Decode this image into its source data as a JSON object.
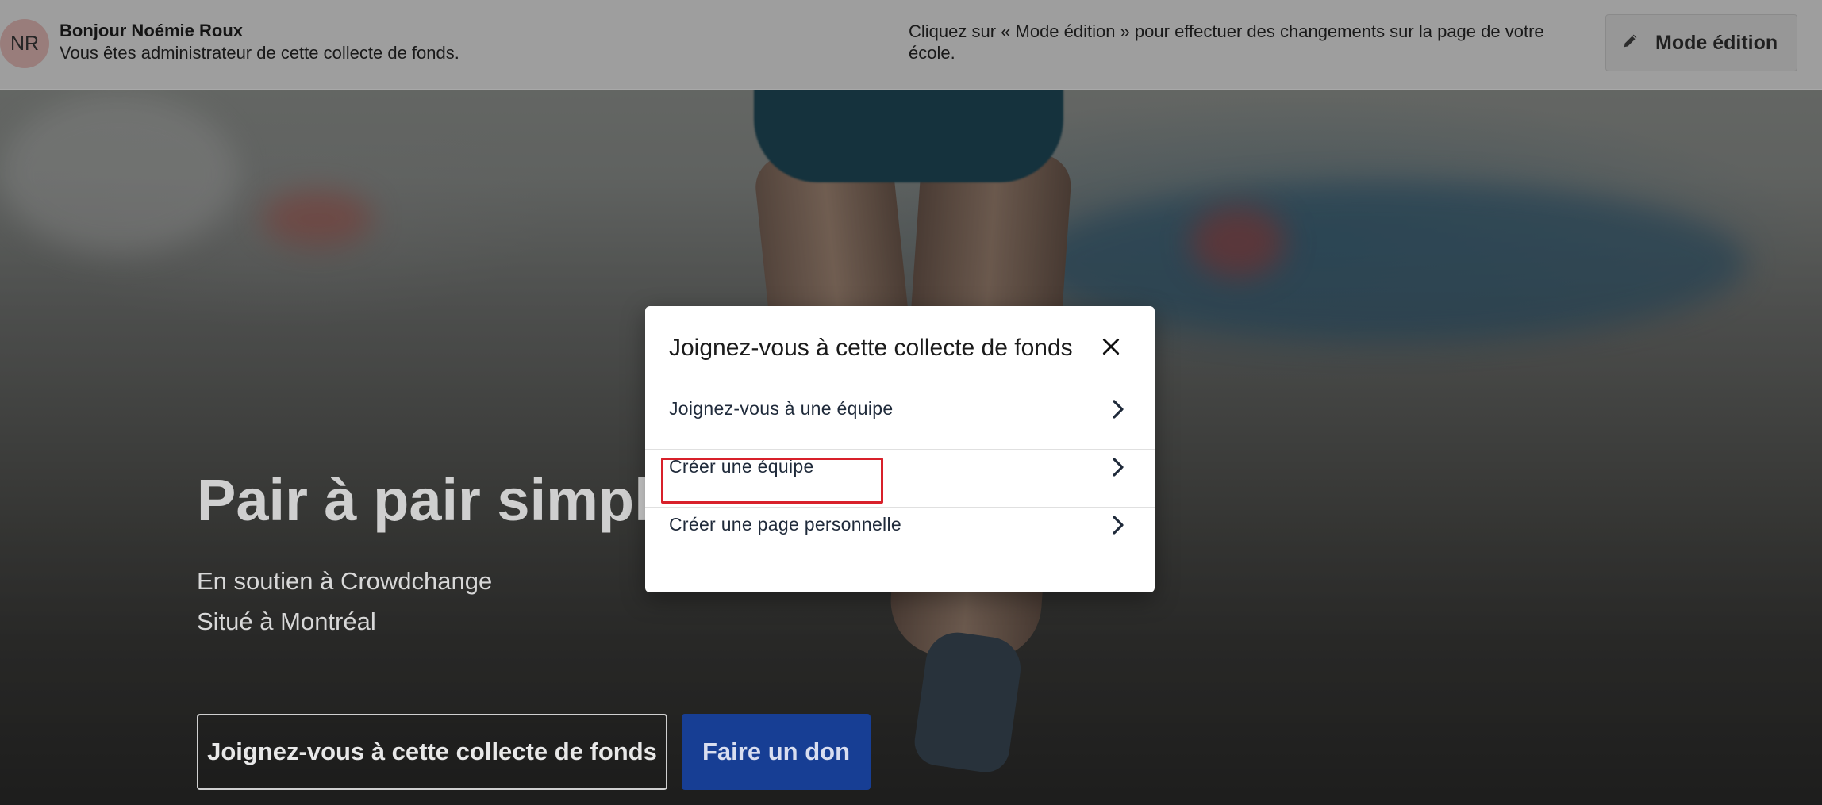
{
  "admin_bar": {
    "avatar_initials": "NR",
    "greeting": "Bonjour Noémie Roux",
    "admin_note": "Vous êtes administrateur de cette collecte de fonds.",
    "edit_hint": "Cliquez sur « Mode édition » pour effectuer des changements sur la page de votre école.",
    "edit_button_label": "Mode édition",
    "edit_icon": "pencil-icon"
  },
  "hero": {
    "title": "Pair à pair simplifi",
    "subtitle_1": "En soutien à Crowdchange",
    "subtitle_2": "Situé à Montréal",
    "join_button_label": "Joignez-vous à cette collecte de fonds",
    "donate_button_label": "Faire un don"
  },
  "modal": {
    "title": "Joignez-vous à cette collecte de fonds",
    "close_icon": "close-icon",
    "options": [
      {
        "label": "Joignez-vous à une équipe",
        "icon": "chevron-right-icon"
      },
      {
        "label": "Créer une équipe",
        "icon": "chevron-right-icon"
      },
      {
        "label": "Créer une page personnelle",
        "icon": "chevron-right-icon"
      }
    ],
    "highlighted_option": "Créer une équipe",
    "highlight_color": "#d8202a"
  },
  "colors": {
    "donate_button": "#173e94",
    "admin_bar": "#d0d0d0"
  }
}
